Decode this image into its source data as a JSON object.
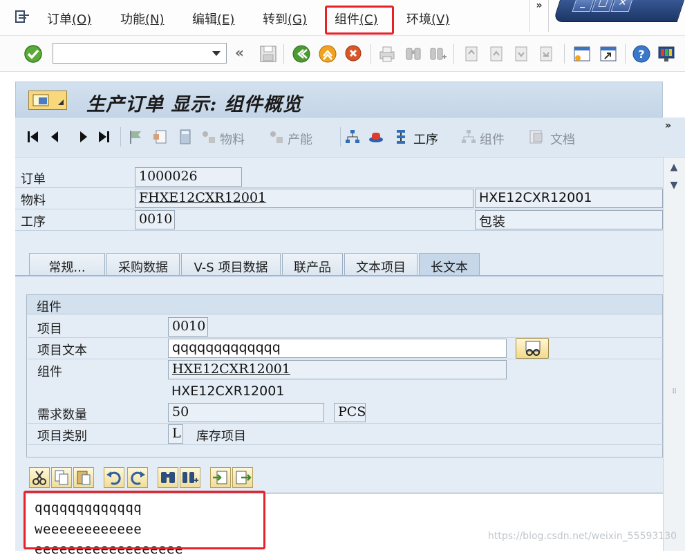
{
  "menu": {
    "items": [
      {
        "label": "订单",
        "key": "(O)"
      },
      {
        "label": "功能",
        "key": "(N)"
      },
      {
        "label": "编辑",
        "key": "(E)"
      },
      {
        "label": "转到",
        "key": "(G)"
      },
      {
        "label": "组件",
        "key": "(C)"
      },
      {
        "label": "环境",
        "key": "(V)"
      }
    ],
    "more": "»"
  },
  "title": "生产订单 显示: 组件概览",
  "app_toolbar": {
    "material": "物料",
    "capacity": "产能",
    "operation": "工序",
    "component": "组件",
    "document": "文档",
    "more": "»"
  },
  "header": {
    "order_label": "订单",
    "order_value": "1000026",
    "material_label": "物料",
    "material_value": "FHXE12CXR12001",
    "material_desc": "HXE12CXR12001",
    "operation_label": "工序",
    "operation_value": "0010",
    "operation_desc": "包装"
  },
  "tabs": [
    "常规...",
    "采购数据",
    "V-S 项目数据",
    "联产品",
    "文本项目",
    "长文本"
  ],
  "group": {
    "title": "组件",
    "item_label": "项目",
    "item_value": "0010",
    "item_text_label": "项目文本",
    "item_text_value": "qqqqqqqqqqqqq",
    "component_label": "组件",
    "component_value": "HXE12CXR12001",
    "component_desc": "HXE12CXR12001",
    "req_qty_label": "需求数量",
    "req_qty_value": "50",
    "unit": "PCS",
    "item_cat_label": "项目类别",
    "item_cat_value": "L",
    "item_cat_desc": "库存项目"
  },
  "long_text": {
    "line1": "qqqqqqqqqqqqq",
    "line2": "weeeeeeeeeeee",
    "line3": "eeeeeeeeeeeeeeeeee"
  },
  "watermark": "https://blog.csdn.net/weixin_55593130",
  "colors": {
    "highlight": "#e8202a",
    "title_bg": "#c4d5e7",
    "content_bg": "#e4edf6"
  }
}
